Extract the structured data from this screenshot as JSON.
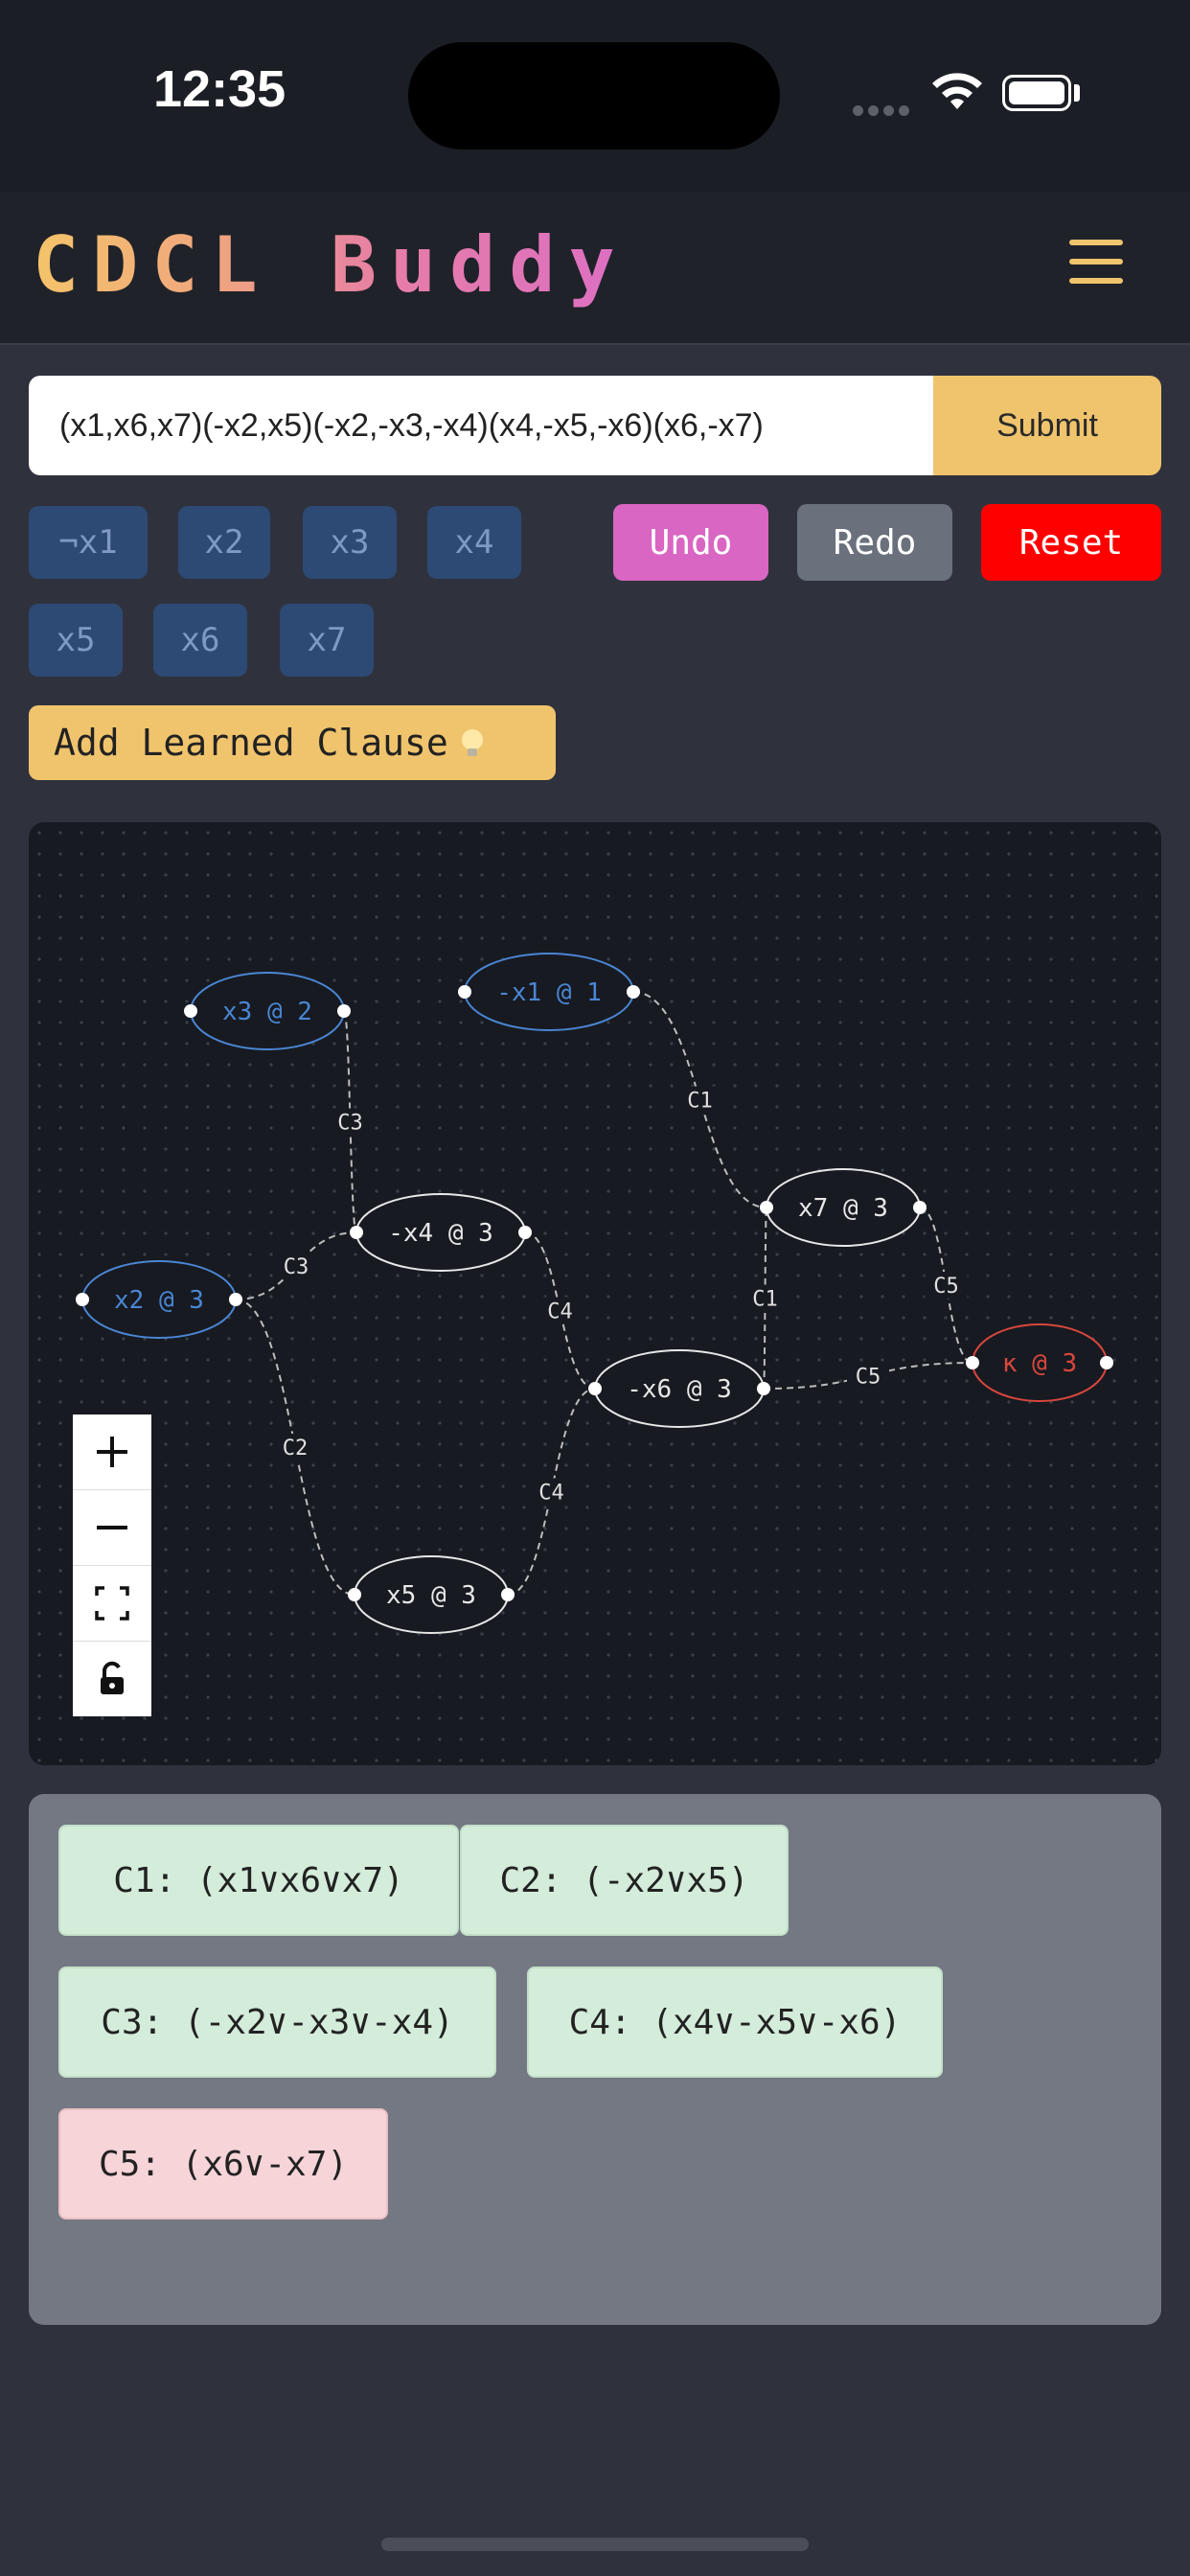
{
  "status_bar": {
    "time": "12:35"
  },
  "header": {
    "title": "CDCL Buddy"
  },
  "formula": {
    "value": "(x1,x6,x7)(-x2,x5)(-x2,-x3,-x4)(x4,-x5,-x6)(x6,-x7)",
    "submit_label": "Submit"
  },
  "variables": [
    "¬x1",
    "x2",
    "x3",
    "x4",
    "x5",
    "x6",
    "x7"
  ],
  "controls": {
    "undo": "Undo",
    "redo": "Redo",
    "reset": "Reset"
  },
  "learn_button": "Add Learned Clause",
  "graph": {
    "nodes": [
      {
        "id": "x3",
        "label": "x3 @ 2",
        "kind": "decision"
      },
      {
        "id": "nx1",
        "label": "-x1 @ 1",
        "kind": "decision"
      },
      {
        "id": "nx4",
        "label": "-x4 @ 3",
        "kind": "implied"
      },
      {
        "id": "x7",
        "label": "x7 @ 3",
        "kind": "implied"
      },
      {
        "id": "x2",
        "label": "x2 @ 3",
        "kind": "decision"
      },
      {
        "id": "nx6",
        "label": "-x6 @ 3",
        "kind": "implied"
      },
      {
        "id": "kappa",
        "label": "κ @ 3",
        "kind": "conflict"
      },
      {
        "id": "x5",
        "label": "x5 @ 3",
        "kind": "implied"
      }
    ],
    "edges": [
      {
        "from": "x3",
        "to": "nx4",
        "label": "C3"
      },
      {
        "from": "x2",
        "to": "nx4",
        "label": "C3"
      },
      {
        "from": "nx1",
        "to": "x7",
        "label": "C1"
      },
      {
        "from": "nx4",
        "to": "nx6",
        "label": "C4"
      },
      {
        "from": "x2",
        "to": "x5",
        "label": "C2"
      },
      {
        "from": "x5",
        "to": "nx6",
        "label": "C4"
      },
      {
        "from": "nx6",
        "to": "x7",
        "label": "C1"
      },
      {
        "from": "nx6",
        "to": "kappa",
        "label": "C5"
      },
      {
        "from": "x7",
        "to": "kappa",
        "label": "C5"
      }
    ],
    "colors": {
      "decision": "#4a86d4",
      "implied": "#e8e8e8",
      "conflict": "#d9473d",
      "edge": "#bdbdbd"
    }
  },
  "clauses": [
    {
      "text": "C1: (x1∨x6∨x7)",
      "status": "satisfied"
    },
    {
      "text": "C2: (-x2∨x5)",
      "status": "satisfied"
    },
    {
      "text": "C3: (-x2∨-x3∨-x4)",
      "status": "satisfied"
    },
    {
      "text": "C4: (x4∨-x5∨-x6)",
      "status": "satisfied"
    },
    {
      "text": "C5: (x6∨-x7)",
      "status": "conflict"
    }
  ],
  "accent_colors": {
    "undo": "#d966c2",
    "redo": "#6b717c",
    "reset": "#ff0000",
    "submit": "#f0c46d"
  }
}
